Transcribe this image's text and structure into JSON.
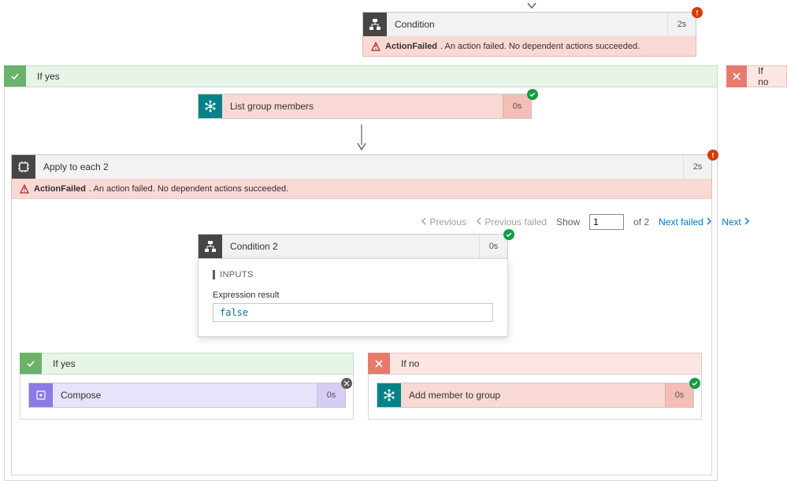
{
  "condition": {
    "title": "Condition",
    "timing": "2s",
    "error_code": "ActionFailed",
    "error_msg": ". An action failed. No dependent actions succeeded."
  },
  "branches": {
    "yes_label": "If yes",
    "no_label": "If no"
  },
  "list_group_members": {
    "title": "List group members",
    "timing": "0s"
  },
  "apply_to_each": {
    "title": "Apply to each 2",
    "timing": "2s",
    "error_code": "ActionFailed",
    "error_msg": ". An action failed. No dependent actions succeeded."
  },
  "pager": {
    "prev": "Previous",
    "prev_failed": "Previous failed",
    "show": "Show",
    "value": "1",
    "of_text": "of 2",
    "next_failed": "Next failed",
    "next": "Next"
  },
  "condition2": {
    "title": "Condition 2",
    "timing": "0s",
    "inputs_header": "INPUTS",
    "expr_label": "Expression result",
    "expr_value": "false"
  },
  "inner": {
    "yes_label": "If yes",
    "no_label": "If no",
    "compose": {
      "title": "Compose",
      "timing": "0s"
    },
    "add_member": {
      "title": "Add member to group",
      "timing": "0s"
    }
  }
}
